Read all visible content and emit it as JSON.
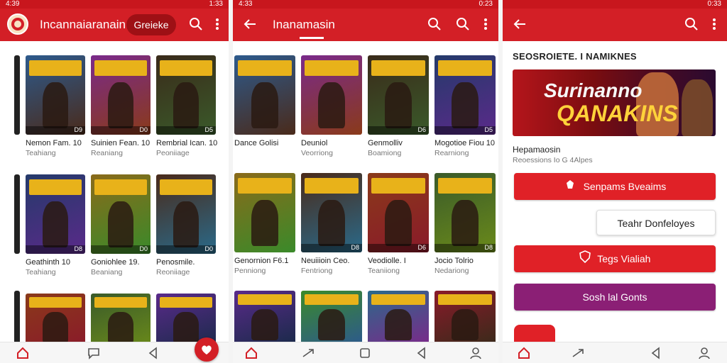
{
  "colors": {
    "accent": "#d31f26",
    "accent_dark": "#9e1015",
    "purple": "#8b1f75",
    "tile_palette": [
      "#2d5a8c",
      "#7a2a8a",
      "#3a2a1a",
      "#243a6a",
      "#8a6a1a",
      "#4a2a1a",
      "#8a3a1a",
      "#3a5a2a",
      "#5a2a8a",
      "#3a8a2a",
      "#2a6a8a",
      "#8a1a2a",
      "#6a8a1a",
      "#1a2a4a"
    ]
  },
  "status_bar": {
    "left_time": "4:39",
    "left_right": "1:33",
    "middle_time": "4:33",
    "middle_right": "0:23",
    "right_right": "0:33"
  },
  "screen1": {
    "app_title": "Incannaiaranain",
    "chip_label": "Greieke",
    "icons": [
      "app-logo-icon",
      "search-icon",
      "more-vertical-icon"
    ],
    "rows": [
      [
        {
          "title": "Nemon Fam. 10",
          "subtitle": "Teahiang",
          "badge": "D9"
        },
        {
          "title": "Suinien Fean. 10",
          "subtitle": "Reaniang",
          "badge": "D0"
        },
        {
          "title": "Rembrial Ican. 10",
          "subtitle": "Peoniiage",
          "badge": "D5"
        }
      ],
      [
        {
          "title": "Geathinth 10",
          "subtitle": "Teahiang",
          "badge": "D8"
        },
        {
          "title": "Goniohlee 19.",
          "subtitle": "Beaniang",
          "badge": "D0"
        },
        {
          "title": "Penosmile.",
          "subtitle": "Reoniiage",
          "badge": "D0"
        }
      ],
      [
        {
          "title": "",
          "subtitle": "",
          "badge": ""
        },
        {
          "title": "",
          "subtitle": "",
          "badge": ""
        },
        {
          "title": "",
          "subtitle": "",
          "badge": ""
        }
      ]
    ],
    "nav": [
      "home-icon",
      "chat-icon",
      "back-icon"
    ]
  },
  "screen2": {
    "app_title": "Inanamasin",
    "icons": [
      "back-arrow-icon",
      "search-icon",
      "search-icon",
      "more-vertical-icon"
    ],
    "rows": [
      [
        {
          "title": "Dance Golisi",
          "subtitle": "",
          "badge": ""
        },
        {
          "title": "Deuniol",
          "subtitle": "Veorriong",
          "badge": ""
        },
        {
          "title": "Genmolliv",
          "subtitle": "Boamiong",
          "badge": "D6"
        },
        {
          "title": "Mogotioe Fiou 10",
          "subtitle": "Rearniong",
          "badge": "D5"
        }
      ],
      [
        {
          "title": "Genornion F6.1",
          "subtitle": "Penniong",
          "badge": ""
        },
        {
          "title": "Neuiiioin Ceo.",
          "subtitle": "Fentriong",
          "badge": "D8"
        },
        {
          "title": "Veodiolle. I",
          "subtitle": "Teaniiong",
          "badge": "D6"
        },
        {
          "title": "Jocio Tolrio",
          "subtitle": "Nedariong",
          "badge": "D8"
        }
      ],
      [
        {
          "title": "",
          "subtitle": "",
          "badge": ""
        },
        {
          "title": "",
          "subtitle": "",
          "badge": ""
        },
        {
          "title": "",
          "subtitle": "",
          "badge": ""
        },
        {
          "title": "",
          "subtitle": "",
          "badge": ""
        }
      ]
    ],
    "nav": [
      "home-icon",
      "cast-icon",
      "square-icon",
      "back-icon",
      "profile-icon"
    ]
  },
  "screen3": {
    "icons": [
      "back-arrow-icon",
      "search-icon",
      "more-vertical-icon"
    ],
    "section_title": "SEOSROIETE. I NAMIKNES",
    "feature_line1": "Surinanno",
    "feature_line2": "QANAKINS",
    "detail_name": "Hepamaosin",
    "detail_meta": "Reoessions Io G 4Alpes",
    "btn_primary": "Senpams Bveaims",
    "btn_secondary": "Teahr Donfeloyes",
    "btn_tertiary": "Tegs Vialiah",
    "btn_purple": "Sosh lal Gonts",
    "nav": [
      "home-icon",
      "cast-icon",
      "back-icon",
      "profile-icon"
    ]
  }
}
